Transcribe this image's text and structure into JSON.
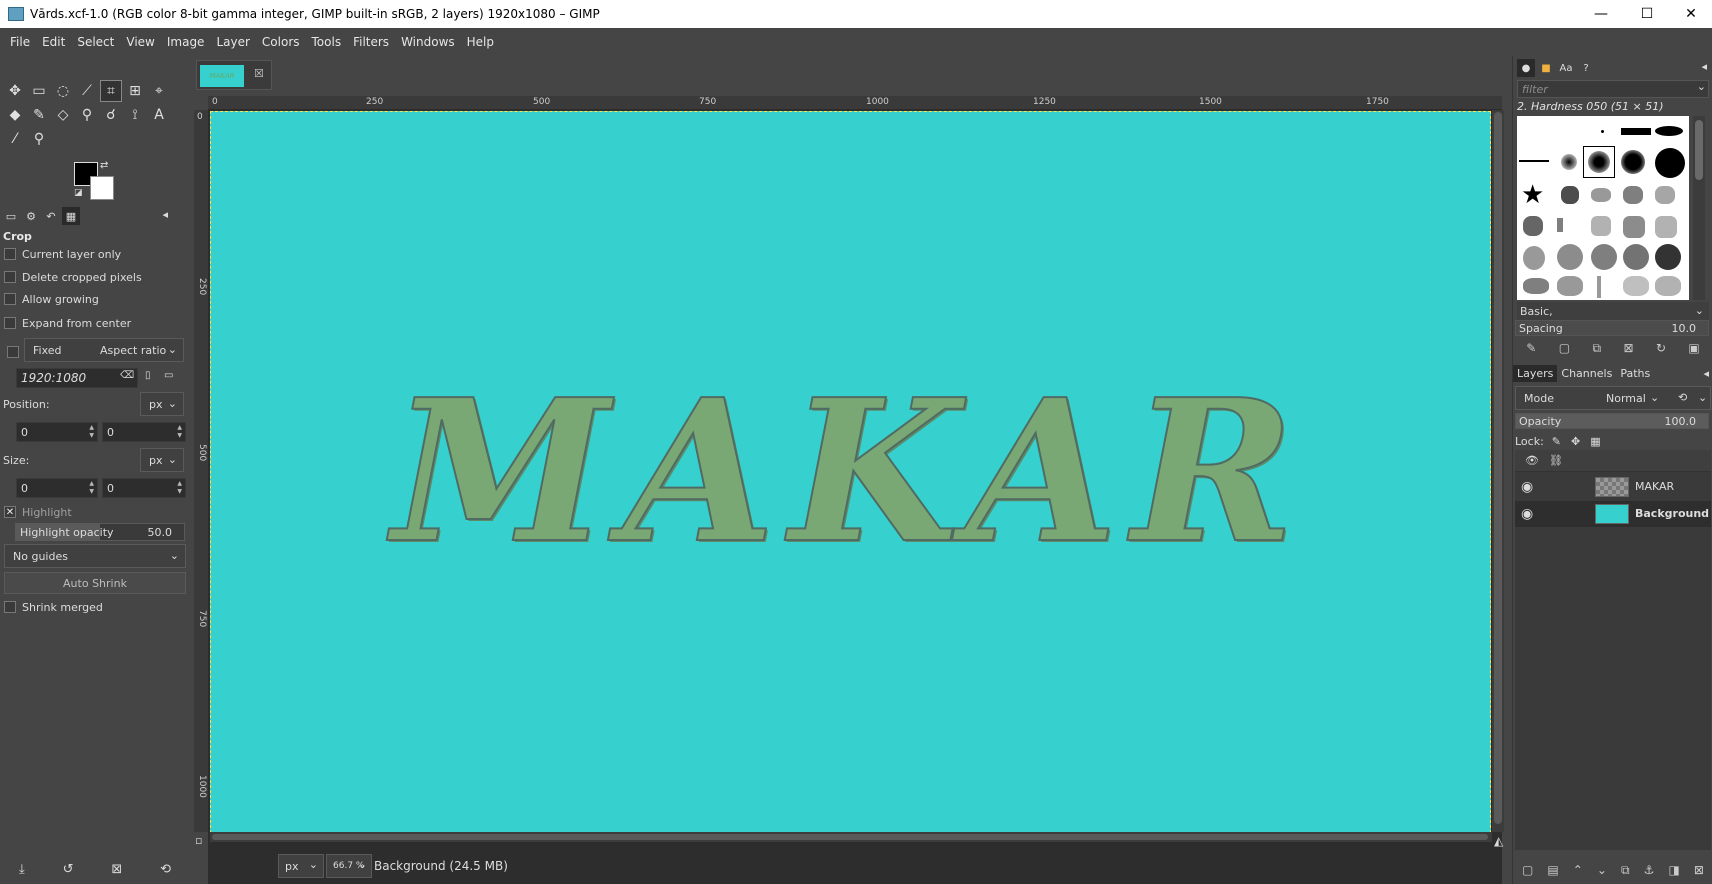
{
  "window": {
    "title": "Vārds.xcf-1.0 (RGB color 8-bit gamma integer, GIMP built-in sRGB, 2 layers) 1920x1080 – GIMP",
    "controls": [
      "—",
      "☐",
      "✕"
    ]
  },
  "menu": [
    "File",
    "Edit",
    "Select",
    "View",
    "Image",
    "Layer",
    "Colors",
    "Tools",
    "Filters",
    "Windows",
    "Help"
  ],
  "tool_options": {
    "title": "Crop",
    "current_layer_only": "Current layer only",
    "delete_cropped": "Delete cropped pixels",
    "allow_growing": "Allow growing",
    "expand_center": "Expand from center",
    "fixed_label": "Fixed",
    "fixed_mode": "Aspect ratio",
    "ratio_value": "1920:1080",
    "position_label": "Position:",
    "position_unit": "px",
    "position_x": "0",
    "position_y": "0",
    "size_label": "Size:",
    "size_unit": "px",
    "size_w": "0",
    "size_h": "0",
    "highlight": "Highlight",
    "highlight_opacity_label": "Highlight opacity",
    "highlight_opacity_value": "50.0",
    "highlight_opacity_fraction": 0.5,
    "guides": "No guides",
    "auto_shrink": "Auto Shrink",
    "shrink_merged": "Shrink merged"
  },
  "image_tab": {
    "thumb_text": "MAKAR"
  },
  "ruler": {
    "h_ticks": [
      "0",
      "250",
      "500",
      "750",
      "1000",
      "1250",
      "1500",
      "1750"
    ],
    "v_ticks": [
      "0",
      "250",
      "500",
      "750",
      "1000"
    ]
  },
  "canvas": {
    "text": "MAKAR",
    "bg_color": "#36d1cf"
  },
  "status": {
    "unit": "px",
    "zoom": "66.7 %",
    "info": "Background (24.5 MB)"
  },
  "brushes": {
    "filter_placeholder": "filter",
    "selected": "2. Hardness 050 (51 × 51)",
    "set": "Basic,",
    "spacing_label": "Spacing",
    "spacing_value": "10.0"
  },
  "layers": {
    "tabs": [
      "Layers",
      "Channels",
      "Paths"
    ],
    "mode_label": "Mode",
    "mode_value": "Normal",
    "opacity_label": "Opacity",
    "opacity_value": "100.0",
    "lock_label": "Lock:",
    "items": [
      {
        "name": "MAKAR",
        "selected": false
      },
      {
        "name": "Background",
        "selected": true
      }
    ]
  }
}
